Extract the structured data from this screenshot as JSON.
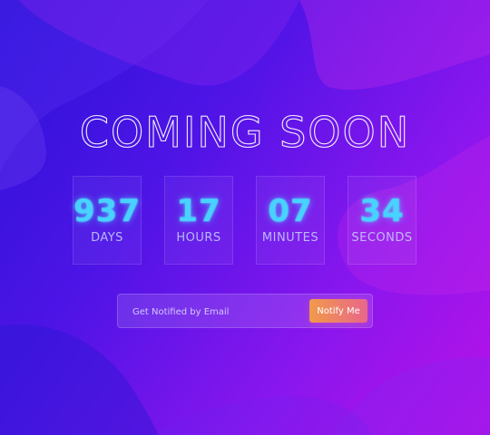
{
  "title": "COMING SOON",
  "countdown": [
    {
      "value": "937",
      "label": "DAYS"
    },
    {
      "value": "17",
      "label": "HOURS"
    },
    {
      "value": "07",
      "label": "MINUTES"
    },
    {
      "value": "34",
      "label": "SECONDS"
    }
  ],
  "notify": {
    "placeholder": "Get Notified by Email",
    "button_label": "Notify Me"
  },
  "colors": {
    "background_start": "#2a12d8",
    "background_end": "#b812e6",
    "counter_number": "#47d2ff",
    "button_start": "#f19a4a",
    "button_end": "#e8668a"
  }
}
